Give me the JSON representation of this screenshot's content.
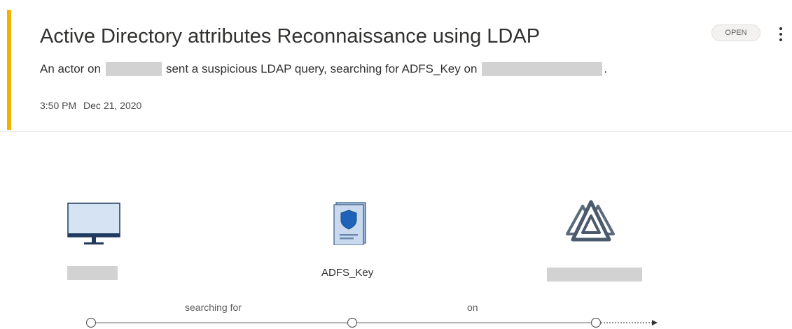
{
  "alert": {
    "title": "Active Directory attributes Reconnaissance using LDAP",
    "description_prefix": "An actor on",
    "description_middle": "sent a suspicious LDAP query, searching for ADFS_Key on",
    "description_suffix": ".",
    "time": "3:50 PM",
    "date": "Dec 21, 2020",
    "status": "OPEN",
    "severity_color": "#f2b200"
  },
  "graph": {
    "nodes": [
      {
        "icon": "computer-icon",
        "label": ""
      },
      {
        "icon": "key-document-icon",
        "label": "ADFS_Key"
      },
      {
        "icon": "domain-icon",
        "label": ""
      }
    ],
    "edges": [
      {
        "label": "searching for"
      },
      {
        "label": "on"
      }
    ]
  }
}
